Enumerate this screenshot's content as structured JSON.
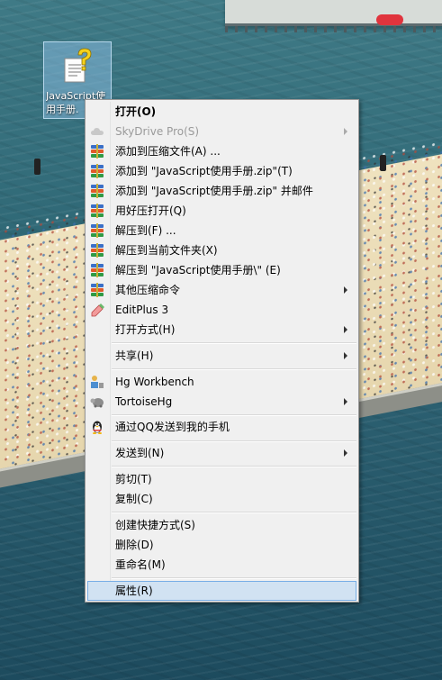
{
  "desktop": {
    "icon_label": "JavaScript使用手册",
    "icon_label_line1": "JavaScript使",
    "icon_label_line2": "用手册."
  },
  "menu": {
    "items": [
      {
        "label": "打开(O)",
        "bold": true,
        "icon": "none"
      },
      {
        "label": "SkyDrive Pro(S)",
        "disabled": true,
        "submenu": true,
        "icon": "cloud-icon"
      },
      {
        "label": "添加到压缩文件(A) ...",
        "icon": "winrar-icon"
      },
      {
        "label": "添加到 \"JavaScript使用手册.zip\"(T)",
        "icon": "winrar-icon"
      },
      {
        "label": "添加到 \"JavaScript使用手册.zip\" 并邮件",
        "icon": "winrar-icon"
      },
      {
        "label": "用好压打开(Q)",
        "icon": "winrar-icon"
      },
      {
        "label": "解压到(F) ...",
        "icon": "winrar-icon"
      },
      {
        "label": "解压到当前文件夹(X)",
        "icon": "winrar-icon"
      },
      {
        "label": "解压到 \"JavaScript使用手册\\\" (E)",
        "icon": "winrar-icon"
      },
      {
        "label": "其他压缩命令",
        "submenu": true,
        "icon": "winrar-icon"
      },
      {
        "label": "EditPlus 3",
        "icon": "editplus-icon"
      },
      {
        "label": "打开方式(H)",
        "submenu": true,
        "icon": "none"
      },
      {
        "label": "共享(H)",
        "submenu": true,
        "icon": "none"
      },
      {
        "label": "Hg Workbench",
        "icon": "hg-workbench-icon"
      },
      {
        "label": "TortoiseHg",
        "submenu": true,
        "icon": "tortoisehg-icon"
      },
      {
        "label": "通过QQ发送到我的手机",
        "icon": "qq-penguin-icon"
      },
      {
        "label": "发送到(N)",
        "submenu": true,
        "icon": "none"
      },
      {
        "label": "剪切(T)",
        "icon": "none"
      },
      {
        "label": "复制(C)",
        "icon": "none"
      },
      {
        "label": "创建快捷方式(S)",
        "icon": "none"
      },
      {
        "label": "删除(D)",
        "icon": "none"
      },
      {
        "label": "重命名(M)",
        "icon": "none"
      },
      {
        "label": "属性(R)",
        "hover": true,
        "icon": "none"
      }
    ]
  },
  "colors": {
    "menu_bg": "#f0f0f0",
    "hover_bg": "#d1e2f2",
    "hover_border": "#78aee5",
    "disabled_text": "#9a9a9a"
  }
}
